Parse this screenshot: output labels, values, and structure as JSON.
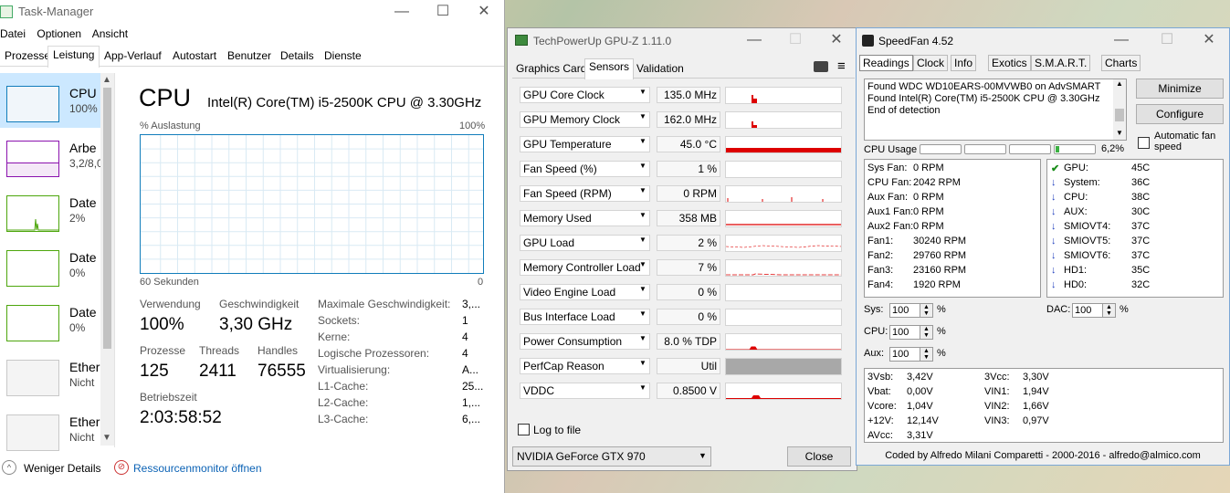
{
  "taskmanager": {
    "title": "Task-Manager",
    "menu": [
      "Datei",
      "Optionen",
      "Ansicht"
    ],
    "tabs": [
      "Prozesse",
      "Leistung",
      "App-Verlauf",
      "Autostart",
      "Benutzer",
      "Details",
      "Dienste"
    ],
    "active_tab": "Leistung",
    "sidebar": [
      {
        "name": "CPU",
        "sub": "100%"
      },
      {
        "name": "Arbe",
        "sub": "3,2/8,0"
      },
      {
        "name": "Date",
        "sub": "2%"
      },
      {
        "name": "Date",
        "sub": "0%"
      },
      {
        "name": "Date",
        "sub": "0%"
      },
      {
        "name": "Ether",
        "sub": "Nicht"
      },
      {
        "name": "Ether",
        "sub": "Nicht"
      }
    ],
    "header": {
      "title": "CPU",
      "model": "Intel(R) Core(TM) i5-2500K CPU @ 3.30GHz"
    },
    "graph": {
      "y_label": "% Auslastung",
      "y_max": "100%",
      "x_label": "60 Sekunden",
      "x_min": "0"
    },
    "stats": {
      "usage_label": "Verwendung",
      "usage_value": "100%",
      "speed_label": "Geschwindigkeit",
      "speed_value": "3,30 GHz",
      "processes_label": "Prozesse",
      "processes_value": "125",
      "threads_label": "Threads",
      "threads_value": "2411",
      "handles_label": "Handles",
      "handles_value": "76555",
      "uptime_label": "Betriebszeit",
      "uptime_value": "2:03:58:52"
    },
    "info": [
      {
        "label": "Maximale Geschwindigkeit:",
        "value": "3,..."
      },
      {
        "label": "Sockets:",
        "value": "1"
      },
      {
        "label": "Kerne:",
        "value": "4"
      },
      {
        "label": "Logische Prozessoren:",
        "value": "4"
      },
      {
        "label": "Virtualisierung:",
        "value": "A..."
      },
      {
        "label": "L1-Cache:",
        "value": "25..."
      },
      {
        "label": "L2-Cache:",
        "value": "1,..."
      },
      {
        "label": "L3-Cache:",
        "value": "6,..."
      }
    ],
    "footer": {
      "less_details": "Weniger Details",
      "resource_monitor": "Ressourcenmonitor öffnen"
    }
  },
  "gpuz": {
    "title": "TechPowerUp GPU-Z 1.11.0",
    "tabs": [
      "Graphics Card",
      "Sensors",
      "Validation"
    ],
    "active_tab": "Sensors",
    "sensors": [
      {
        "label": "GPU Core Clock",
        "value": "135.0 MHz"
      },
      {
        "label": "GPU Memory Clock",
        "value": "162.0 MHz"
      },
      {
        "label": "GPU Temperature",
        "value": "45.0 °C"
      },
      {
        "label": "Fan Speed (%)",
        "value": "1 %"
      },
      {
        "label": "Fan Speed (RPM)",
        "value": "0 RPM"
      },
      {
        "label": "Memory Used",
        "value": "358 MB"
      },
      {
        "label": "GPU Load",
        "value": "2 %"
      },
      {
        "label": "Memory Controller Load",
        "value": "7 %"
      },
      {
        "label": "Video Engine Load",
        "value": "0 %"
      },
      {
        "label": "Bus Interface Load",
        "value": "0 %"
      },
      {
        "label": "Power Consumption",
        "value": "8.0 % TDP"
      },
      {
        "label": "PerfCap Reason",
        "value": "Util"
      },
      {
        "label": "VDDC",
        "value": "0.8500 V"
      }
    ],
    "log_to_file": "Log to file",
    "device": "NVIDIA GeForce GTX 970",
    "close_label": "Close"
  },
  "speedfan": {
    "title": "SpeedFan 4.52",
    "tabs": [
      "Readings",
      "Clock",
      "Info",
      "Exotics",
      "S.M.A.R.T.",
      "Charts"
    ],
    "log_lines": [
      "Found WDC WD10EARS-00MVWB0 on AdvSMART",
      "Found Intel(R) Core(TM) i5-2500K CPU @ 3.30GHz",
      "End of detection"
    ],
    "minimize_label": "Minimize",
    "configure_label": "Configure",
    "auto_fan_label": "Automatic fan speed",
    "cpu_usage_label": "CPU Usage",
    "cpu_usage_value": "6,2%",
    "fans": [
      {
        "label": "Sys Fan:",
        "value": "0 RPM"
      },
      {
        "label": "CPU Fan:",
        "value": "2042 RPM"
      },
      {
        "label": "Aux Fan:",
        "value": "0 RPM"
      },
      {
        "label": "Aux1 Fan:",
        "value": "0 RPM"
      },
      {
        "label": "Aux2 Fan:",
        "value": "0 RPM"
      },
      {
        "label": "Fan1:",
        "value": "30240 RPM"
      },
      {
        "label": "Fan2:",
        "value": "29760 RPM"
      },
      {
        "label": "Fan3:",
        "value": "23160 RPM"
      },
      {
        "label": "Fan4:",
        "value": "1920 RPM"
      }
    ],
    "temps": [
      {
        "label": "GPU:",
        "value": "45C",
        "icon": "check-icon"
      },
      {
        "label": "System:",
        "value": "36C",
        "icon": "arrow-down-icon"
      },
      {
        "label": "CPU:",
        "value": "38C",
        "icon": "arrow-down-icon"
      },
      {
        "label": "AUX:",
        "value": "30C",
        "icon": "arrow-down-icon"
      },
      {
        "label": "SMIOVT4:",
        "value": "37C",
        "icon": "arrow-down-icon"
      },
      {
        "label": "SMIOVT5:",
        "value": "37C",
        "icon": "arrow-down-icon"
      },
      {
        "label": "SMIOVT6:",
        "value": "37C",
        "icon": "arrow-down-icon"
      },
      {
        "label": "HD1:",
        "value": "35C",
        "icon": "arrow-down-icon"
      },
      {
        "label": "HD0:",
        "value": "32C",
        "icon": "arrow-down-icon"
      }
    ],
    "speeds": [
      {
        "label": "Sys:",
        "value": "100",
        "unit": "%"
      },
      {
        "label": "CPU:",
        "value": "100",
        "unit": "%"
      },
      {
        "label": "Aux:",
        "value": "100",
        "unit": "%"
      }
    ],
    "dac": {
      "label": "DAC:",
      "value": "100",
      "unit": "%"
    },
    "voltages_left": [
      {
        "label": "3Vsb:",
        "value": "3,42V"
      },
      {
        "label": "Vbat:",
        "value": "0,00V"
      },
      {
        "label": "Vcore:",
        "value": "1,04V"
      },
      {
        "label": "+12V:",
        "value": "12,14V"
      },
      {
        "label": "AVcc:",
        "value": "3,31V"
      }
    ],
    "voltages_right": [
      {
        "label": "3Vcc:",
        "value": "3,30V"
      },
      {
        "label": "VIN1:",
        "value": "1,94V"
      },
      {
        "label": "VIN2:",
        "value": "1,66V"
      },
      {
        "label": "VIN3:",
        "value": "0,97V"
      }
    ],
    "footer": "Coded by Alfredo Milani Comparetti - 2000-2016 - alfredo@almico.com"
  }
}
